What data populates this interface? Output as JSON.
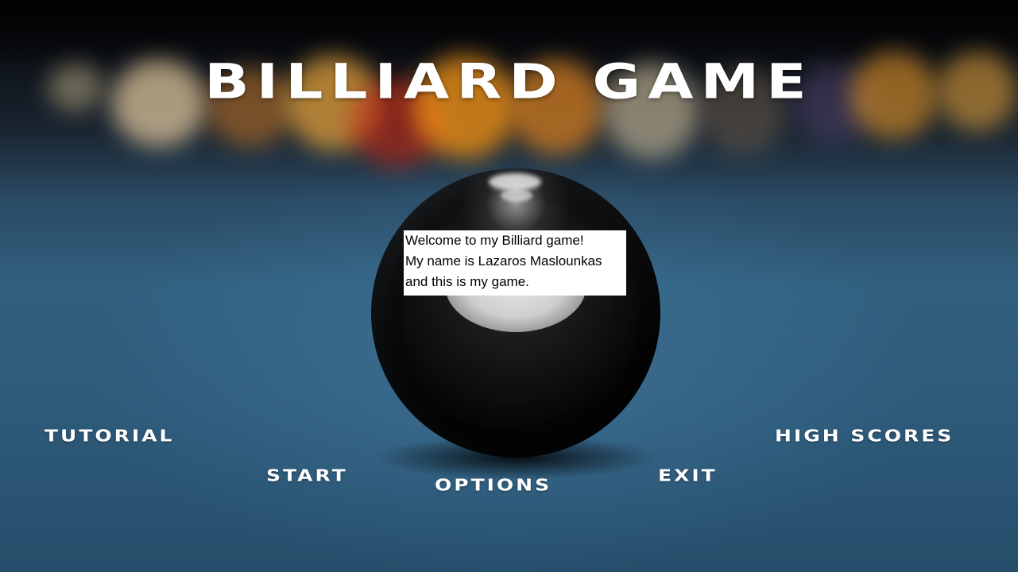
{
  "game": {
    "title": "BILLIARD GAME",
    "welcome_lines": [
      "Welcome to my Billiard game!",
      "My name is Lazaros Maslounkas",
      "and this is my game."
    ],
    "menu": {
      "tutorial": "TUTORIAL",
      "start": "START",
      "options": "OPTIONS",
      "exit": "EXIT",
      "high_scores": "HIGH SCORES"
    }
  },
  "colors": {
    "felt": "#31607f",
    "text": "#ffffff",
    "ball": "#050505"
  }
}
